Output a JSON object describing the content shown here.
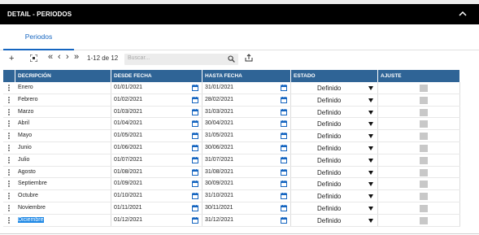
{
  "header": {
    "title": "DETAIL - PERIODOS",
    "collapse_icon": "chevron-up-icon"
  },
  "tabs": [
    {
      "label": "Periodos"
    }
  ],
  "toolbar": {
    "add_label": "+",
    "expand_icon": "expand-icon",
    "first_label": "«",
    "prev_label": "‹",
    "next_label": "›",
    "last_label": "»",
    "range_label": "1-12 de 12",
    "search_placeholder": "Buscar...",
    "export_icon": "export-icon"
  },
  "table": {
    "columns": [
      "DECRIPCIÓN",
      "DESDE FECHA",
      "HASTA FECHA",
      "ESTADO",
      "AJUSTE"
    ],
    "rows": [
      {
        "descripcion": "Enero",
        "desde": "01/01/2021",
        "hasta": "31/01/2021",
        "estado": "Definido"
      },
      {
        "descripcion": "Febrero",
        "desde": "01/02/2021",
        "hasta": "28/02/2021",
        "estado": "Definido"
      },
      {
        "descripcion": "Marzo",
        "desde": "01/03/2021",
        "hasta": "31/03/2021",
        "estado": "Definido"
      },
      {
        "descripcion": "Abril",
        "desde": "01/04/2021",
        "hasta": "30/04/2021",
        "estado": "Definido"
      },
      {
        "descripcion": "Mayo",
        "desde": "01/05/2021",
        "hasta": "31/05/2021",
        "estado": "Definido"
      },
      {
        "descripcion": "Junio",
        "desde": "01/06/2021",
        "hasta": "30/06/2021",
        "estado": "Definido"
      },
      {
        "descripcion": "Julio",
        "desde": "01/07/2021",
        "hasta": "31/07/2021",
        "estado": "Definido"
      },
      {
        "descripcion": "Agosto",
        "desde": "01/08/2021",
        "hasta": "31/08/2021",
        "estado": "Definido"
      },
      {
        "descripcion": "Septiembre",
        "desde": "01/09/2021",
        "hasta": "30/09/2021",
        "estado": "Definido"
      },
      {
        "descripcion": "Octubre",
        "desde": "01/10/2021",
        "hasta": "31/10/2021",
        "estado": "Definido"
      },
      {
        "descripcion": "Noviembre",
        "desde": "01/11/2021",
        "hasta": "30/11/2021",
        "estado": "Definido"
      },
      {
        "descripcion": "Diciembre",
        "desde": "01/12/2021",
        "hasta": "31/12/2021",
        "estado": "Definido"
      }
    ]
  },
  "colors": {
    "header_bg": "#000000",
    "grid_header_bg": "#2f6496",
    "tab_accent": "#1565c0",
    "selection": "#1e88e5",
    "calendar_icon": "#1565c0"
  }
}
